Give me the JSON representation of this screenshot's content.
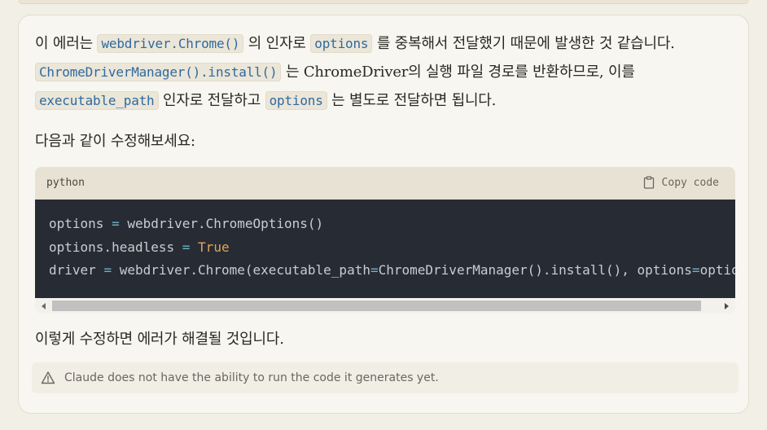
{
  "message": {
    "para1": {
      "t1": "이 에러는 ",
      "c1": "webdriver.Chrome()",
      "t2": " 의 인자로 ",
      "c2": "options",
      "t3": " 를 중복해서 전달했기 때문에 발생한 것 같습니다. ",
      "c3": "ChromeDriverManager().install()",
      "t4": " 는 ChromeDriver의 실행 파일 경로를 반환하므로, 이를 ",
      "c4": "executable_path",
      "t5": " 인자로 전달하고 ",
      "c5": "options",
      "t6": " 는 별도로 전달하면 됩니다."
    },
    "para2": "다음과 같이 수정해보세요:",
    "code": {
      "language": "python",
      "copy_label": "Copy code",
      "line1": {
        "a": "options ",
        "op": "=",
        "b": " webdriver.ChromeOptions()"
      },
      "line2": {
        "a": "options.headless ",
        "op": "=",
        "b": " ",
        "val": "True"
      },
      "line3": {
        "a": "driver ",
        "op1": "=",
        "b": " webdriver.Chrome(executable_path",
        "op2": "=",
        "c": "ChromeDriverManager().install(), options",
        "op3": "=",
        "d": "options)"
      }
    },
    "para3": "이렇게 수정하면 에러가 해결될 것입니다.",
    "disclaimer": "Claude does not have the ability to run the code it generates yet."
  },
  "icons": {
    "copy": "clipboard-icon",
    "warning": "warning-triangle-icon"
  }
}
